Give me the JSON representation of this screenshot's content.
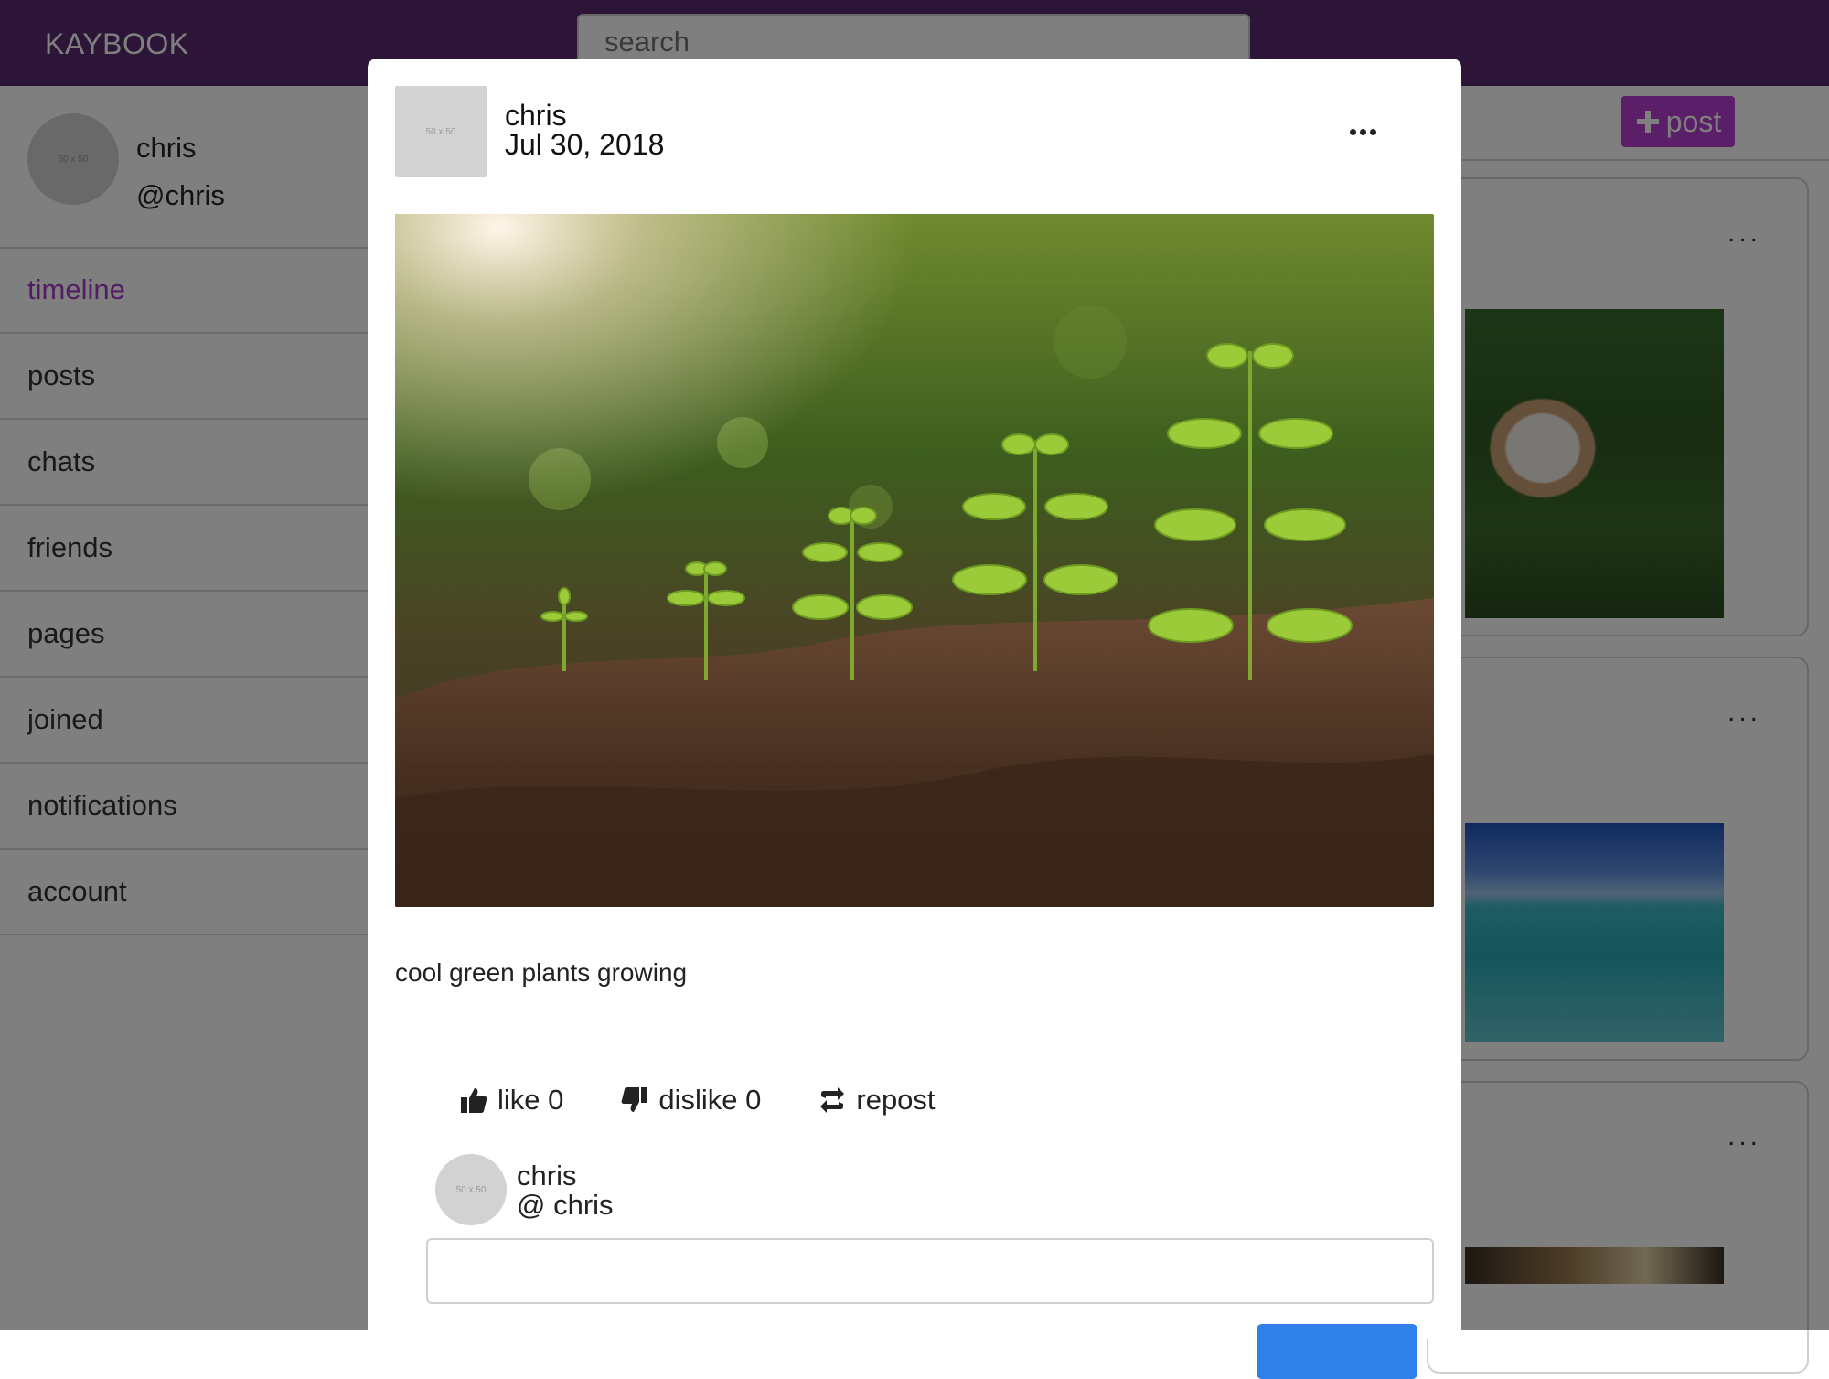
{
  "app": {
    "logo": "KAYBOOK",
    "search_placeholder": "search",
    "post_button_label": "post",
    "accent_color": "#b43fd1",
    "header_color": "#5b2a6e"
  },
  "sidebar": {
    "profile": {
      "name": "chris",
      "handle": "@chris",
      "avatar_text": "50 x 50"
    },
    "items": [
      {
        "label": "timeline",
        "active": true
      },
      {
        "label": "posts"
      },
      {
        "label": "chats"
      },
      {
        "label": "friends"
      },
      {
        "label": "pages"
      },
      {
        "label": "joined"
      },
      {
        "label": "notifications"
      },
      {
        "label": "account"
      }
    ]
  },
  "feed": {
    "cards": [
      {
        "menu": "...",
        "image": "puppy in garden"
      },
      {
        "menu": "...",
        "image": "ocean beach"
      },
      {
        "menu": "...",
        "image": "blurred photo"
      }
    ]
  },
  "modal": {
    "author": {
      "name": "chris",
      "date": "Jul 30, 2018",
      "avatar_text": "50 x 50"
    },
    "more_icon": "ellipsis-icon",
    "image": "seedlings growing in soil",
    "caption": "cool green plants growing",
    "actions": {
      "like_label": "like 0",
      "dislike_label": "dislike 0",
      "repost_label": "repost"
    },
    "commenter": {
      "name": "chris",
      "handle": "@ chris",
      "avatar_text": "50 x 50"
    },
    "comment_value": "",
    "submit_color": "#2f80e8"
  }
}
